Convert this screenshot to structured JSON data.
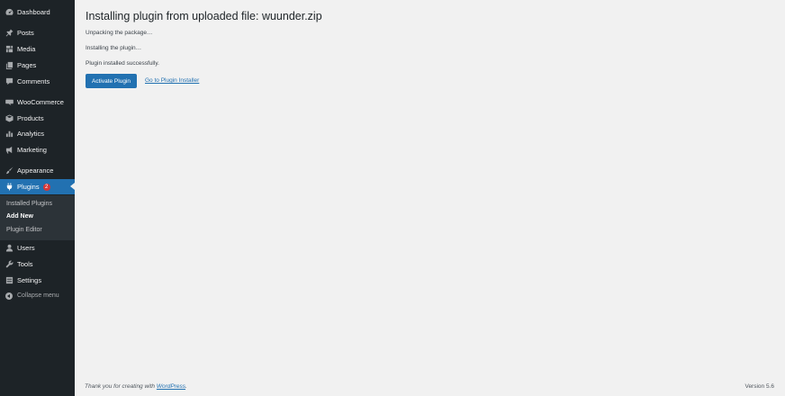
{
  "sidebar": {
    "items": [
      {
        "label": "Dashboard",
        "icon": "dashboard-icon"
      },
      {
        "label": "Posts",
        "icon": "pin-icon"
      },
      {
        "label": "Media",
        "icon": "media-icon"
      },
      {
        "label": "Pages",
        "icon": "pages-icon"
      },
      {
        "label": "Comments",
        "icon": "comment-icon"
      },
      {
        "label": "WooCommerce",
        "icon": "woocommerce-icon"
      },
      {
        "label": "Products",
        "icon": "box-icon"
      },
      {
        "label": "Analytics",
        "icon": "bar-chart-icon"
      },
      {
        "label": "Marketing",
        "icon": "megaphone-icon"
      },
      {
        "label": "Appearance",
        "icon": "brush-icon"
      },
      {
        "label": "Plugins",
        "icon": "plug-icon",
        "badge": "2",
        "current": true
      },
      {
        "label": "Users",
        "icon": "user-icon"
      },
      {
        "label": "Tools",
        "icon": "wrench-icon"
      },
      {
        "label": "Settings",
        "icon": "settings-icon"
      }
    ],
    "submenu": [
      {
        "label": "Installed Plugins"
      },
      {
        "label": "Add New",
        "current": true
      },
      {
        "label": "Plugin Editor"
      }
    ],
    "collapse_label": "Collapse menu"
  },
  "main": {
    "title": "Installing plugin from uploaded file: wuunder.zip",
    "messages": [
      "Unpacking the package…",
      "Installing the plugin…",
      "Plugin installed successfully."
    ],
    "activate_button": "Activate Plugin",
    "installer_link": "Go to Plugin Installer"
  },
  "footer": {
    "thanks_prefix": "Thank you for creating with",
    "wordpress_link": "WordPress",
    "thanks_suffix": ".",
    "version": "Version 5.6"
  },
  "colors": {
    "sidebar_bg": "#1d2327",
    "submenu_bg": "#2c3338",
    "accent": "#2271b1",
    "badge": "#d63638",
    "page_bg": "#f1f1f1"
  }
}
